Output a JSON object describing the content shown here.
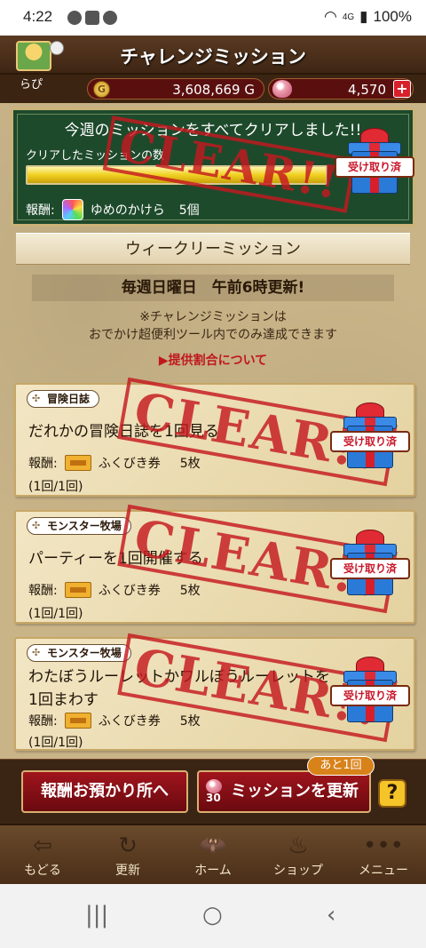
{
  "status_bar": {
    "time": "4:22",
    "network": "4G",
    "battery": "100%"
  },
  "header": {
    "title": "チャレンジミッション",
    "username": "らぴ"
  },
  "currency": {
    "gold": "3,608,669",
    "gold_unit": "G",
    "gems": "4,570",
    "plus": "+"
  },
  "weekly_clear": {
    "title": "今週のミッションをすべてクリアしました!!",
    "progress_label": "クリアしたミッションの数",
    "progress_fraction": 1.0,
    "reward_label": "報酬:",
    "reward_item": "ゆめのかけら",
    "reward_count": "5個",
    "claimed_label": "受け取り済"
  },
  "section": {
    "title": "ウィークリーミッション",
    "update_schedule": "毎週日曜日　午前6時更新!",
    "note_line1": "※チャレンジミッションは",
    "note_line2": "おでかけ超便利ツール内でのみ達成できます",
    "rate_link": "▶提供割合について"
  },
  "stamp_text": "CLEAR!!",
  "missions": [
    {
      "category": "冒険日誌",
      "text": "だれかの冒険日誌を1回見る",
      "reward_label": "報酬:",
      "reward_item": "ふくびき券",
      "reward_count": "5枚",
      "progress": "(1回/1回)",
      "claimed_label": "受け取り済"
    },
    {
      "category": "モンスター牧場",
      "text": "パーティーを1回開催する",
      "reward_label": "報酬:",
      "reward_item": "ふくびき券",
      "reward_count": "5枚",
      "progress": "(1回/1回)",
      "claimed_label": "受け取り済"
    },
    {
      "category": "モンスター牧場",
      "text": "わたぼうルーレットかワルぼうルーレットを1回まわす",
      "reward_label": "報酬:",
      "reward_item": "ふくびき券",
      "reward_count": "5枚",
      "progress": "(1回/1回)",
      "claimed_label": "受け取り済"
    }
  ],
  "footer": {
    "deposit_label": "報酬お預かり所へ",
    "refresh_label": "ミッションを更新",
    "refresh_cost": "30",
    "remaining_badge": "あと1回",
    "help_label": "?"
  },
  "bottom_nav": [
    {
      "label": "もどる",
      "icon": "back-arrow-icon"
    },
    {
      "label": "更新",
      "icon": "refresh-flame-icon"
    },
    {
      "label": "ホーム",
      "icon": "dracky-home-icon"
    },
    {
      "label": "ショップ",
      "icon": "slime-shop-icon"
    },
    {
      "label": "メニュー",
      "icon": "menu-dots-icon"
    }
  ]
}
